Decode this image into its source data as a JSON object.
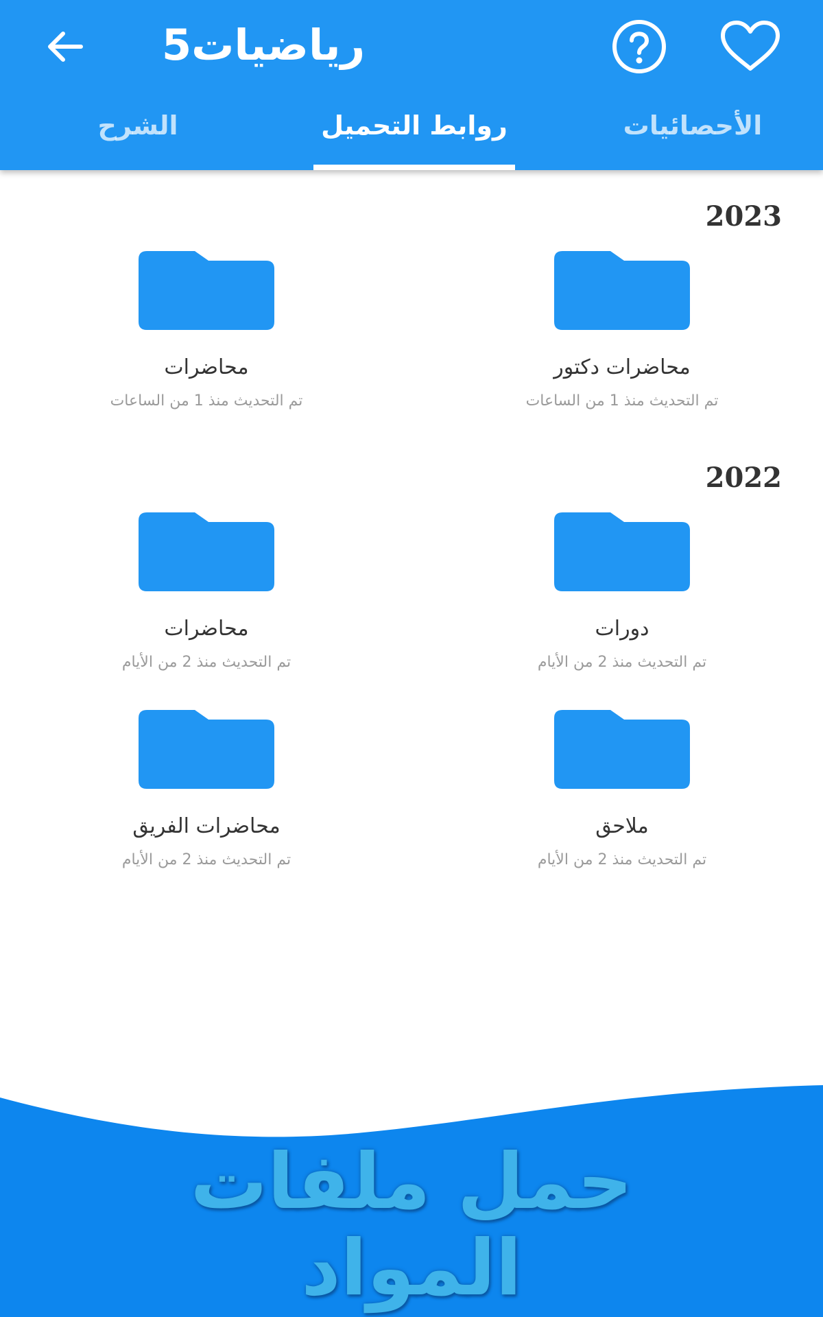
{
  "header": {
    "title": "رياضيات5",
    "back_icon": "arrow-left-icon",
    "help_icon": "help-circle-icon",
    "favorite_icon": "heart-outline-icon"
  },
  "tabs": [
    {
      "label": "الشرح",
      "active": false
    },
    {
      "label": "روابط التحميل",
      "active": true
    },
    {
      "label": "الأحصائيات",
      "active": false
    }
  ],
  "sections": [
    {
      "year": "2023",
      "folders": [
        {
          "name": "محاضرات دكتور",
          "updated": "تم التحديث منذ  1  من الساعات"
        },
        {
          "name": "محاضرات",
          "updated": "تم التحديث منذ  1  من الساعات"
        }
      ]
    },
    {
      "year": "2022",
      "folders": [
        {
          "name": "دورات",
          "updated": "تم التحديث منذ  2  من الأيام"
        },
        {
          "name": "محاضرات",
          "updated": "تم التحديث منذ  2  من الأيام"
        },
        {
          "name": "ملاحق",
          "updated": "تم التحديث منذ  2  من الأيام"
        },
        {
          "name": "محاضرات الفريق",
          "updated": "تم التحديث منذ  2  من الأيام"
        }
      ]
    }
  ],
  "banner": {
    "line1": "حمل ملفات",
    "line2": "المواد"
  },
  "colors": {
    "primary": "#2196F3",
    "folder": "#2196F3",
    "banner": "#0D86EE"
  }
}
